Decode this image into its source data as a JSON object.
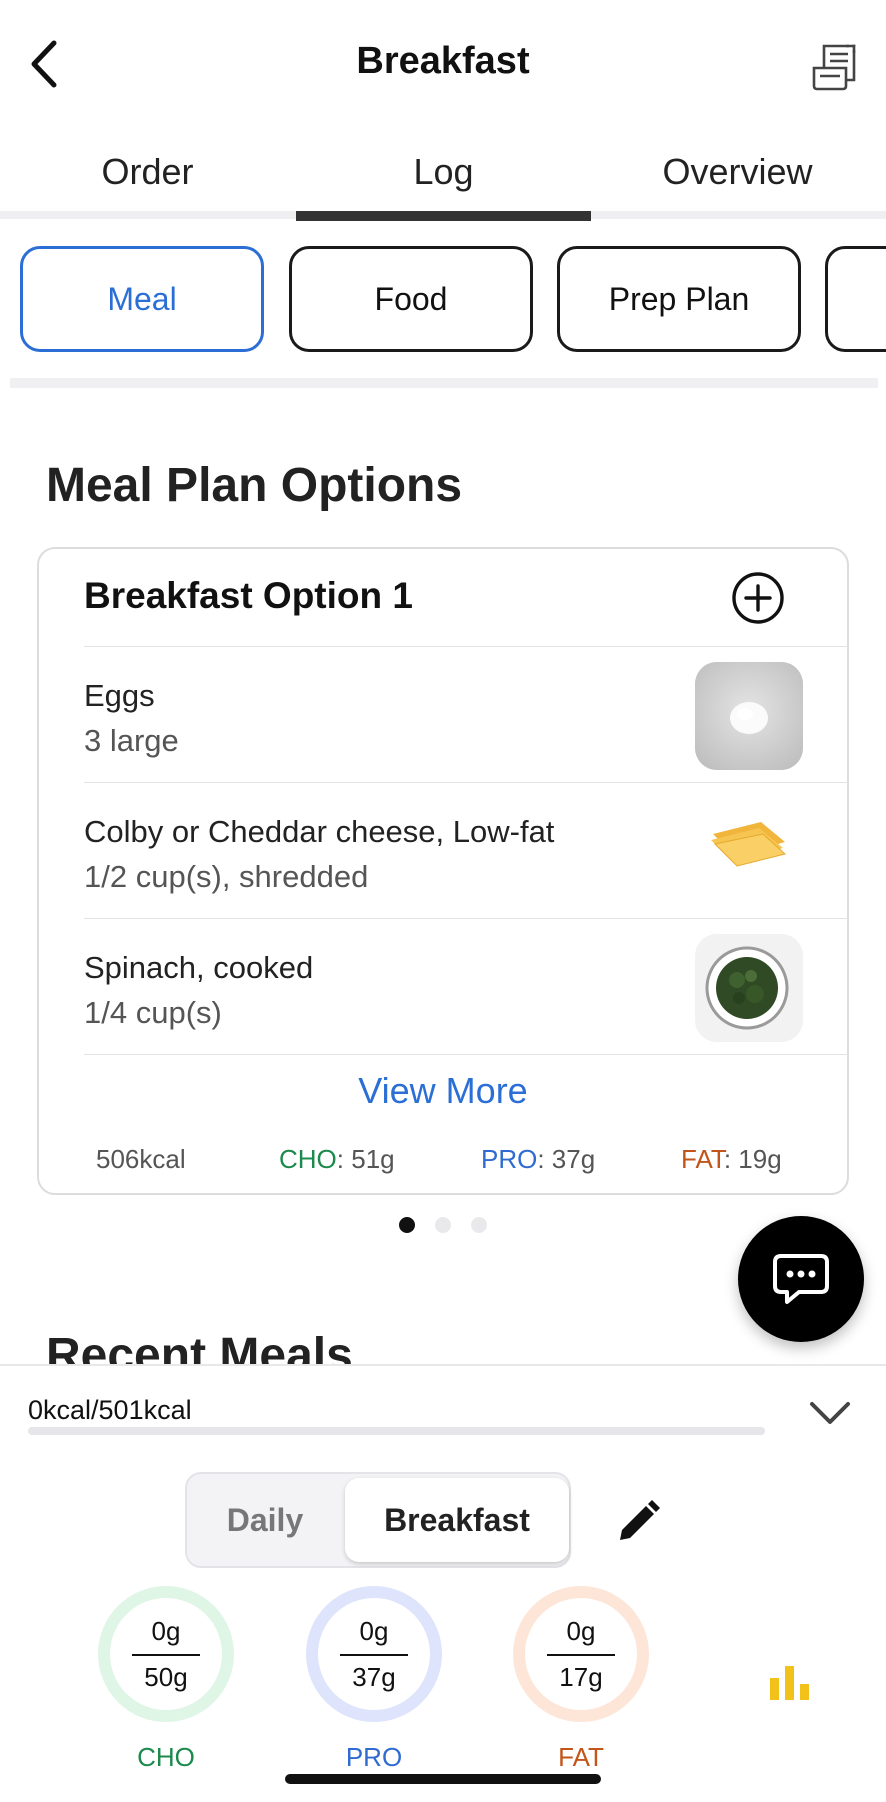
{
  "header": {
    "title": "Breakfast"
  },
  "tabs": [
    {
      "label": "Order"
    },
    {
      "label": "Log"
    },
    {
      "label": "Overview"
    }
  ],
  "chips": [
    {
      "label": "Meal"
    },
    {
      "label": "Food"
    },
    {
      "label": "Prep Plan"
    }
  ],
  "meal_plan": {
    "section_title": "Meal Plan Options",
    "option_title": "Breakfast Option 1",
    "items": [
      {
        "name": "Eggs",
        "qty": "3 large",
        "image": "egg-photo"
      },
      {
        "name": "Colby or Cheddar cheese, Low-fat",
        "qty": "1/2 cup(s), shredded",
        "image": "cheese-slices-photo"
      },
      {
        "name": "Spinach, cooked",
        "qty": "1/4 cup(s)",
        "image": "spinach-bowl-photo"
      }
    ],
    "view_more": "View More",
    "macros": {
      "kcal": "506kcal",
      "cho_label": "CHO",
      "cho_value": ": 51g",
      "pro_label": "PRO",
      "pro_value": ": 37g",
      "fat_label": "FAT",
      "fat_value": ": 19g"
    },
    "pager": {
      "count": 3,
      "active": 1
    }
  },
  "recent_meals": {
    "title": "Recent Meals"
  },
  "summary": {
    "kcal_text": "0kcal/501kcal",
    "progress": 0,
    "segment": {
      "daily": "Daily",
      "meal": "Breakfast",
      "selected": "Breakfast"
    },
    "rings": [
      {
        "label": "CHO",
        "current": "0g",
        "target": "50g"
      },
      {
        "label": "PRO",
        "current": "0g",
        "target": "37g"
      },
      {
        "label": "FAT",
        "current": "0g",
        "target": "17g"
      }
    ]
  },
  "colors": {
    "accent_blue": "#2b6fd6",
    "cho": "#1b8a4c",
    "pro": "#2f6bd0",
    "fat": "#c4551a",
    "cho_ring": "#dff5e6",
    "pro_ring": "#dde4fb",
    "fat_ring": "#fde6d8",
    "chart_icon": "#f2c21a"
  },
  "icons": {
    "back": "chevron-left-icon",
    "receipt": "receipt-icon",
    "add": "plus-circle-icon",
    "chat": "chat-bubble-icon",
    "collapse": "chevron-down-icon",
    "edit": "pencil-icon",
    "stats": "bar-chart-icon"
  }
}
